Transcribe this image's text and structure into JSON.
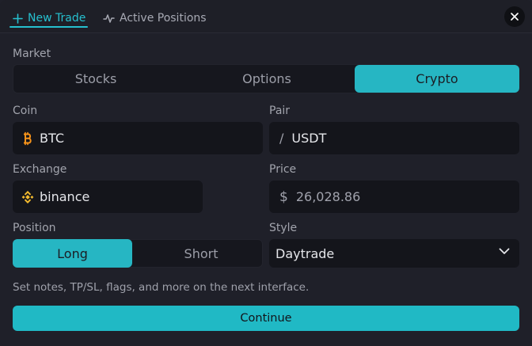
{
  "tabs": [
    {
      "label": "New Trade",
      "icon": "plus-icon",
      "active": true
    },
    {
      "label": "Active Positions",
      "icon": "pulse-icon",
      "active": false
    }
  ],
  "close_icon": "close-icon",
  "market": {
    "label": "Market",
    "options": [
      "Stocks",
      "Options",
      "Crypto"
    ],
    "selected": "Crypto"
  },
  "coin": {
    "label": "Coin",
    "value": "BTC",
    "icon": "bitcoin-icon"
  },
  "pair": {
    "label": "Pair",
    "prefix": "/",
    "value": "USDT"
  },
  "exchange": {
    "label": "Exchange",
    "value": "binance",
    "icon": "binance-icon"
  },
  "price": {
    "label": "Price",
    "prefix": "$",
    "value": "26,028.86"
  },
  "position": {
    "label": "Position",
    "options": [
      "Long",
      "Short"
    ],
    "selected": "Long"
  },
  "style": {
    "label": "Style",
    "value": "Daytrade",
    "icon": "chevron-down-icon"
  },
  "hint": "Set notes, TP/SL, flags, and more on the next interface.",
  "continue_label": "Continue",
  "colors": {
    "accent": "#26c0cf",
    "background": "#1f2029",
    "field": "#14151b"
  }
}
